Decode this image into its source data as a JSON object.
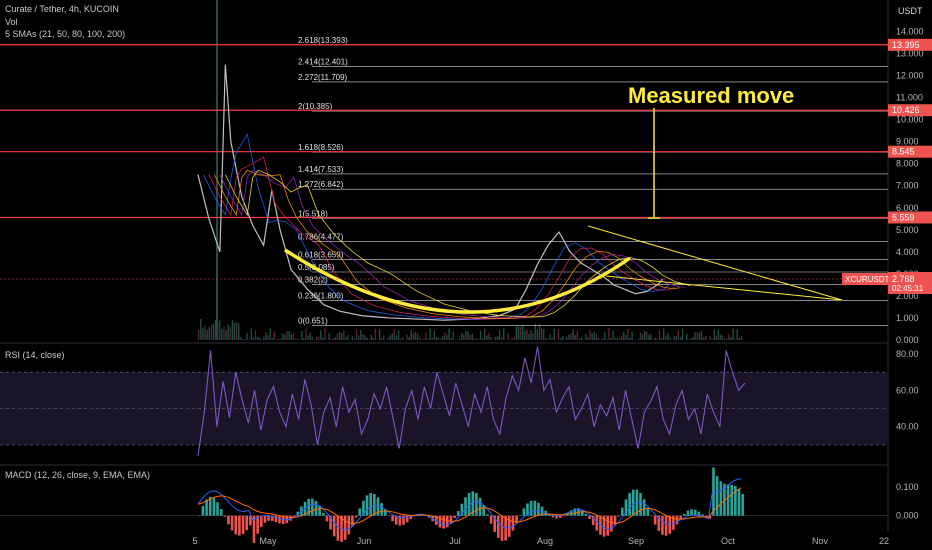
{
  "header": {
    "symbol_line": "Curate / Tether, 4h, KUCOIN",
    "volume_label": "Vol",
    "sma_label": "5 SMAs (21, 50, 80, 100, 200)",
    "currency": "USDT"
  },
  "rsi_label": "RSI (14, close)",
  "macd_label": "MACD (12, 26, close, 9, EMA, EMA)",
  "colors": {
    "background": "#000000",
    "horizontal_levels": "#ff3b3b",
    "fib_lines": "#ffffff",
    "annotation_yellow": "#ffeb3b",
    "rsi_line": "#7e57c2",
    "macd_line": "#2962ff",
    "signal_line": "#ff6d00",
    "hist_up": "#26a69a",
    "hist_down": "#ef5350",
    "price_badge": "#ef5350"
  },
  "chart_data": [
    {
      "type": "line",
      "panel": "price",
      "x_tick_labels": [
        "5",
        "May",
        "Jun",
        "Jul",
        "Aug",
        "Sep",
        "Oct",
        "Nov",
        "22"
      ],
      "y_tick_labels": [
        "0.000",
        "1.000",
        "2.000",
        "3.000",
        "4.000",
        "5.000",
        "6.000",
        "7.000",
        "8.000",
        "9.000",
        "10.000",
        "11.000",
        "12.000",
        "13.000",
        "14.000"
      ],
      "ylim": [
        0,
        15.2
      ],
      "fib_levels": [
        {
          "label": "0(0.651)",
          "value": 0.651
        },
        {
          "label": "0.236(1.800)",
          "value": 1.8
        },
        {
          "label": "0.382(2)",
          "value": 2.51
        },
        {
          "label": "0.5(3.085)",
          "value": 3.085
        },
        {
          "label": "0.618(3.659)",
          "value": 3.659
        },
        {
          "label": "0.786(4.477)",
          "value": 4.477
        },
        {
          "label": "1(5.518)",
          "value": 5.518
        },
        {
          "label": "1.272(6.842)",
          "value": 6.842
        },
        {
          "label": "1.414(7.533)",
          "value": 7.533
        },
        {
          "label": "1.618(8.526)",
          "value": 8.526
        },
        {
          "label": "2(10.385)",
          "value": 10.385
        },
        {
          "label": "2.272(11.709)",
          "value": 11.709
        },
        {
          "label": "2.414(12.401)",
          "value": 12.401
        },
        {
          "label": "2.618(13.393)",
          "value": 13.393
        }
      ],
      "horizontal_levels": [
        {
          "label": "13.395",
          "value": 13.395
        },
        {
          "label": "10.426",
          "value": 10.426
        },
        {
          "label": "8.545",
          "value": 8.545
        },
        {
          "label": "5.559",
          "value": 5.559
        }
      ],
      "current_price": {
        "ticker": "XCURUSDT",
        "price": "2.768",
        "countdown": "02:45:31",
        "value": 2.768
      },
      "annotation": "Measured move",
      "price_path": [
        [
          0.0,
          7.5
        ],
        [
          0.02,
          5.5
        ],
        [
          0.04,
          4.0
        ],
        [
          0.05,
          12.5
        ],
        [
          0.06,
          9.0
        ],
        [
          0.08,
          6.5
        ],
        [
          0.1,
          5.2
        ],
        [
          0.12,
          4.3
        ],
        [
          0.135,
          6.8
        ],
        [
          0.15,
          5.0
        ],
        [
          0.17,
          3.2
        ],
        [
          0.2,
          2.3
        ],
        [
          0.23,
          1.6
        ],
        [
          0.26,
          1.3
        ],
        [
          0.3,
          1.1
        ],
        [
          0.35,
          1.0
        ],
        [
          0.4,
          0.95
        ],
        [
          0.45,
          0.9
        ],
        [
          0.5,
          0.95
        ],
        [
          0.55,
          1.1
        ],
        [
          0.58,
          1.4
        ],
        [
          0.6,
          2.3
        ],
        [
          0.62,
          3.4
        ],
        [
          0.64,
          4.3
        ],
        [
          0.66,
          4.9
        ],
        [
          0.68,
          4.0
        ],
        [
          0.7,
          3.5
        ],
        [
          0.72,
          3.2
        ],
        [
          0.74,
          2.9
        ],
        [
          0.76,
          2.5
        ],
        [
          0.78,
          2.3
        ],
        [
          0.8,
          2.1
        ],
        [
          0.82,
          2.2
        ],
        [
          0.84,
          2.5
        ],
        [
          0.85,
          2.768
        ]
      ]
    },
    {
      "type": "line",
      "panel": "rsi",
      "y_tick_labels": [
        "40.00",
        "60.00",
        "80.00"
      ],
      "ylim": [
        20,
        85
      ],
      "upper_band": 70,
      "mid_band": 50,
      "lower_band": 30,
      "series": [
        {
          "values": [
            24,
            48,
            82,
            40,
            65,
            45,
            70,
            55,
            42,
            60,
            38,
            55,
            62,
            48,
            40,
            58,
            44,
            66,
            52,
            30,
            48,
            56,
            40,
            62,
            48,
            55,
            36,
            44,
            58,
            50,
            62,
            45,
            28,
            50,
            60,
            44,
            62,
            50,
            70,
            58,
            46,
            64,
            52,
            40,
            58,
            48,
            62,
            44,
            36,
            56,
            68,
            60,
            78,
            64,
            84,
            60,
            66,
            48,
            56,
            62,
            44,
            50,
            58,
            40,
            52,
            46,
            56,
            38,
            60,
            44,
            28,
            48,
            54,
            62,
            44,
            36,
            52,
            60,
            44,
            50,
            36,
            58,
            48,
            40,
            82,
            70,
            60,
            64
          ]
        }
      ]
    },
    {
      "type": "bar",
      "panel": "macd",
      "y_tick_labels": [
        "0.000",
        "0.100"
      ],
      "ylim": [
        -0.05,
        0.17
      ]
    }
  ]
}
